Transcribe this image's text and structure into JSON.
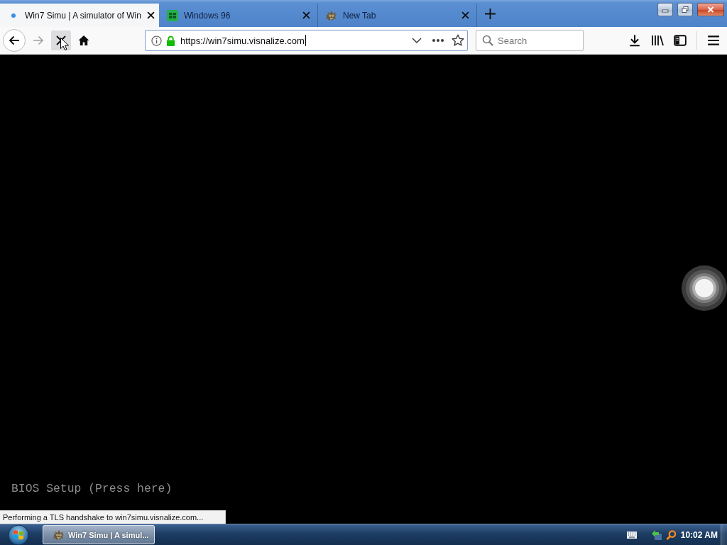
{
  "tabs": [
    {
      "title": "Win7 Simu | A simulator of Win",
      "kind": "dot",
      "selected": true
    },
    {
      "title": "Windows 96",
      "kind": "tile",
      "selected": false
    },
    {
      "title": "New Tab",
      "kind": "critter",
      "selected": false
    }
  ],
  "nav_buttons": [
    {
      "kind": "back",
      "disabled": false,
      "hovered": false
    },
    {
      "kind": "forward",
      "disabled": true,
      "hovered": false
    },
    {
      "kind": "stop",
      "disabled": false,
      "hovered": true
    },
    {
      "kind": "home",
      "disabled": false,
      "hovered": false
    }
  ],
  "address_bar": {
    "url": "https://win7simu.visnalize.com",
    "secure": true,
    "focused": true
  },
  "search": {
    "placeholder": "Search"
  },
  "page": {
    "bios_link": "BIOS Setup (Press here)"
  },
  "status_bar": "Performing a TLS handshake to win7simu.visnalize.com...",
  "taskbar": {
    "tasks": [
      {
        "label": "Win7 Simu | A simul...",
        "selected": true
      }
    ],
    "clock": "10:02 AM"
  }
}
